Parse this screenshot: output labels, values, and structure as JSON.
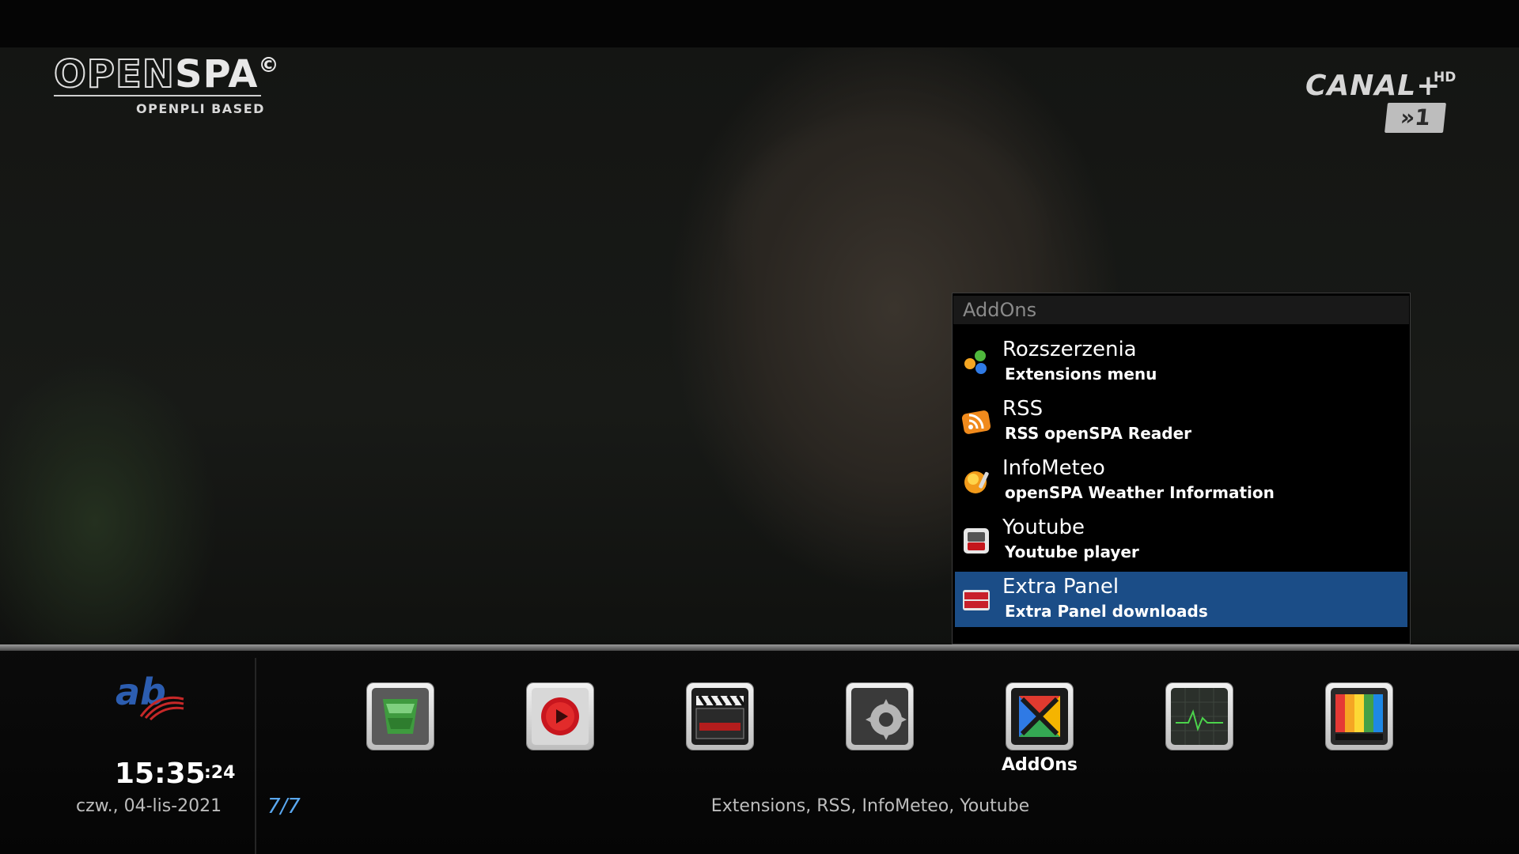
{
  "branding": {
    "image_logo_text": "OPENSPA",
    "image_logo_copyright": "©",
    "image_logo_subtitle": "OPENPLI BASED"
  },
  "channel": {
    "logo_text": "CANAL+",
    "hd_text": "HD",
    "number_text": "»1"
  },
  "addons_panel": {
    "title": "AddOns",
    "items": [
      {
        "name": "Rozszerzenia",
        "description": "Extensions menu",
        "icon": "extensions-icon",
        "selected": false
      },
      {
        "name": "RSS",
        "description": "RSS openSPA Reader",
        "icon": "rss-icon",
        "selected": false
      },
      {
        "name": "InfoMeteo",
        "description": "openSPA Weather Information",
        "icon": "weather-icon",
        "selected": false
      },
      {
        "name": "Youtube",
        "description": "Youtube player",
        "icon": "youtube-icon",
        "selected": false
      },
      {
        "name": "Extra Panel",
        "description": "Extra Panel downloads",
        "icon": "extra-panel-icon",
        "selected": true
      }
    ]
  },
  "bottom_bar": {
    "ab_logo_text": "ab",
    "clock": "15:35",
    "clock_seconds": ":24",
    "date": "czw., 04-lis-2021",
    "page_counter": "7/7",
    "selected_description": "Extensions, RSS, InfoMeteo, Youtube",
    "menu_icons": [
      {
        "icon": "openspa-panel-icon",
        "label": ""
      },
      {
        "icon": "record-icon",
        "label": ""
      },
      {
        "icon": "clapperboard-icon",
        "label": ""
      },
      {
        "icon": "settings-gear-icon",
        "label": ""
      },
      {
        "icon": "addons-icon",
        "label": "AddOns"
      },
      {
        "icon": "monitor-icon",
        "label": ""
      },
      {
        "icon": "tv-icon",
        "label": ""
      }
    ]
  },
  "colors": {
    "selection": "#1b4d87",
    "page_counter": "#5aa8f0",
    "ab_logo": "#2c5db0"
  }
}
